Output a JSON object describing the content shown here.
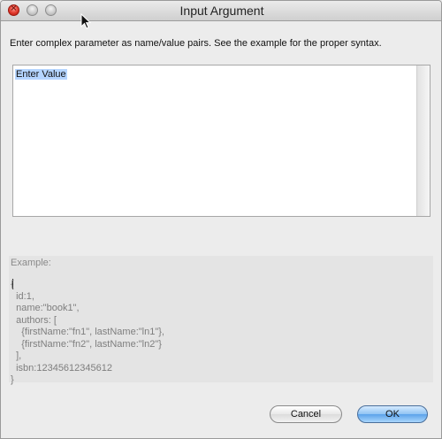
{
  "window": {
    "title": "Input Argument"
  },
  "instructions": "Enter complex parameter as name/value pairs. See the example for the proper syntax.",
  "value_field": {
    "value": "Enter Value"
  },
  "example": {
    "label": "Example:",
    "code": "{\n  id:1,\n  name:\"book1\",\n  authors: [\n    {firstName:\"fn1\", lastName:\"ln1\"},\n    {firstName:\"fn2\", lastName:\"ln2\"}\n  ],\n  isbn:12345612345612\n}"
  },
  "buttons": {
    "cancel_label": "Cancel",
    "ok_label": "OK"
  },
  "colors": {
    "close": "#e0392c",
    "ok_button": "#5ba2ea",
    "selection": "#b5d5ff"
  },
  "icons": {
    "close": "close-icon",
    "minimize": "minimize-icon",
    "zoom": "zoom-icon",
    "cursor": "mouse-pointer-icon"
  }
}
